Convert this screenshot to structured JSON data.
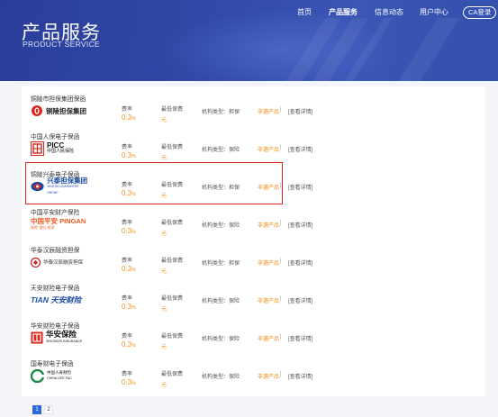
{
  "banner": {
    "title": "产品服务",
    "subtitle": "PRODUCT SERVICE"
  },
  "nav": {
    "items": [
      "首页",
      "产品服务",
      "信息动态",
      "用户中心"
    ],
    "login": "CA登录"
  },
  "labels": {
    "rate": "费率",
    "min_premium": "最低保费",
    "min_premium_unit": "元",
    "select": "非遴产品",
    "separator": "|",
    "detail": "[查看详情]"
  },
  "products": [
    {
      "name": "铜陵市担保集团保函",
      "rate": "0.3",
      "rate_unit": "%",
      "org_type": "机构类型：担保",
      "logo_icon": "tongling-guarantee-logo",
      "logo_text": "铜陵担保集团",
      "logo_color": "#e0231d"
    },
    {
      "name": "中国人保电子保函",
      "rate": "0.3",
      "rate_unit": "%",
      "org_type": "机构类型：保险",
      "logo_icon": "picc-logo",
      "logo_text": "PICC",
      "logo_sub": "中国人民保险",
      "logo_color": "#d9261c"
    },
    {
      "name": "铜陵兴泰电子保函",
      "rate": "0.3",
      "rate_unit": "%",
      "org_type": "机构类型：担保",
      "logo_icon": "xingtai-guarantee-logo",
      "logo_text": "兴泰担保集团",
      "logo_sub": "XINGTAI GUARANTEE GROUP",
      "logo_color": "#1b4aa2"
    },
    {
      "name": "中国平安财产保险",
      "rate": "0.3",
      "rate_unit": "%",
      "org_type": "机构类型：保险",
      "logo_icon": "pingan-logo",
      "logo_text": "中国平安 PINGAN",
      "logo_sub": "保险·银行·投资",
      "logo_color": "#f05a22"
    },
    {
      "name": "华泰汉辰融资担保",
      "rate": "0.3",
      "rate_unit": "%",
      "org_type": "机构类型：担保",
      "logo_icon": "huatai-hanchen-logo",
      "logo_text": "华泰汉辰融资担保",
      "logo_color": "#c81e1e"
    },
    {
      "name": "天安财险电子保函",
      "rate": "0.3",
      "rate_unit": "%",
      "org_type": "机构类型：保险",
      "logo_icon": "tianan-logo",
      "logo_text": "TIAN 天安财险",
      "logo_color": "#1d4fa3"
    },
    {
      "name": "华安财险电子保函",
      "rate": "0.3",
      "rate_unit": "%",
      "org_type": "机构类型：保险",
      "logo_icon": "huaan-logo",
      "logo_text": "华安保险",
      "logo_sub": "SINOSAFE INSURANCE",
      "logo_color": "#d9261c"
    },
    {
      "name": "国寿财电子保函",
      "rate": "0.3",
      "rate_unit": "%",
      "org_type": "机构类型：保险",
      "logo_icon": "china-life-logo",
      "logo_text": "中国人寿财险",
      "logo_sub": "CHINA LIFE P&C",
      "logo_color": "#1f8a4c"
    }
  ],
  "pagination": {
    "pages": [
      "1",
      "2"
    ],
    "current": "1"
  },
  "colors": {
    "accent": "#f29020",
    "banner": "#324aa8",
    "highlight": "#e0231d",
    "page_active": "#2f6bd8"
  }
}
